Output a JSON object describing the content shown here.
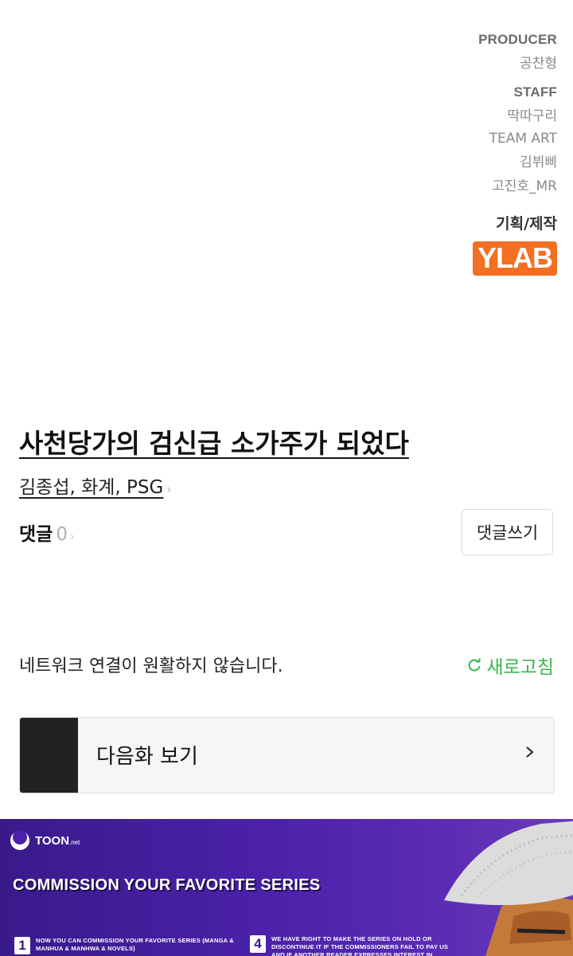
{
  "credits": {
    "producer_heading": "PRODUCER",
    "producer_name": "공찬형",
    "staff_heading": "STAFF",
    "staff_name": "딱따구리",
    "team_art_heading": "TEAM ART",
    "team_art_names": [
      "김뷔삐",
      "고진호_MR"
    ],
    "plan_label": "기획/제작",
    "studio_logo_text": "YLAB",
    "studio_color": "#f36f21"
  },
  "episode": {
    "title": "사천당가의 검신급 소가주가 되었다",
    "authors": "김종섭, 화계, PSG"
  },
  "comments": {
    "label": "댓글",
    "count": "0",
    "write_button": "댓글쓰기"
  },
  "network": {
    "message": "네트워크 연결이 원활하지 않습니다.",
    "refresh_label": "새로고침",
    "refresh_color": "#39b54a"
  },
  "next_episode": {
    "label": "다음화 보기"
  },
  "banner": {
    "logo_text": "TOON",
    "logo_suffix": ".net",
    "headline": "COMMISSION YOUR FAVORITE SERIES",
    "steps": [
      {
        "num": "1",
        "text": "NOW YOU CAN COMMISSION YOUR FAVORITE SERIES (MANGA & MANHUA & MANHWA & NOVELS)"
      },
      {
        "num": "4",
        "text": "WE HAVE RIGHT TO MAKE THE SERIES ON HOLD OR DISCONTINUE IT IF THE COMMISSIONERS FAIL TO PAY US AND IF ANOTHER READER EXPRESSES INTEREST IN SPONSORING IT HE CAN CONTACT US AT OUR SITE"
      }
    ]
  }
}
